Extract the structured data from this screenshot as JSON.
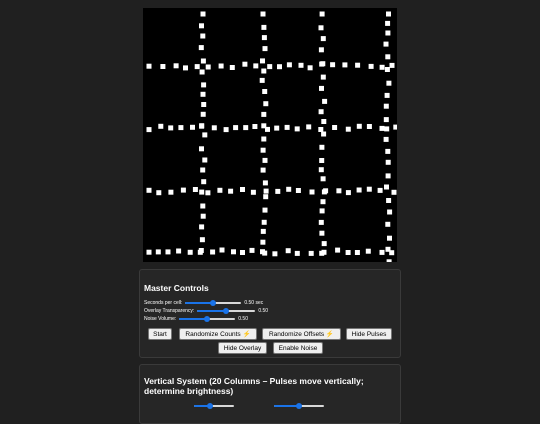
{
  "canvas": {
    "background": "#000000",
    "dot_color": "#ffffff",
    "lines": 4
  },
  "master": {
    "title": "Master Controls",
    "sliders": [
      {
        "label": "Seconds per cell:",
        "value": "0.50 sec",
        "level": 0.5
      },
      {
        "label": "Overlay Transparency:",
        "value": "0.50",
        "level": 0.5
      },
      {
        "label": "Noise Volume:",
        "value": "0.50",
        "level": 0.5
      }
    ],
    "buttons": {
      "start": "Start",
      "randomize_counts": "Randomize Counts ⚡",
      "randomize_offsets": "Randomize Offsets ⚡",
      "hide_pulses": "Hide Pulses",
      "hide_overlay": "Hide Overlay",
      "enable_noise": "Enable Noise"
    }
  },
  "vertical": {
    "title": "Vertical System (20 Columns – Pulses move vertically; determine brightness)"
  },
  "colors": {
    "page_bg": "#202020",
    "panel_bg": "#262626",
    "accent": "#1a73e8",
    "button_bg": "#efefef"
  }
}
